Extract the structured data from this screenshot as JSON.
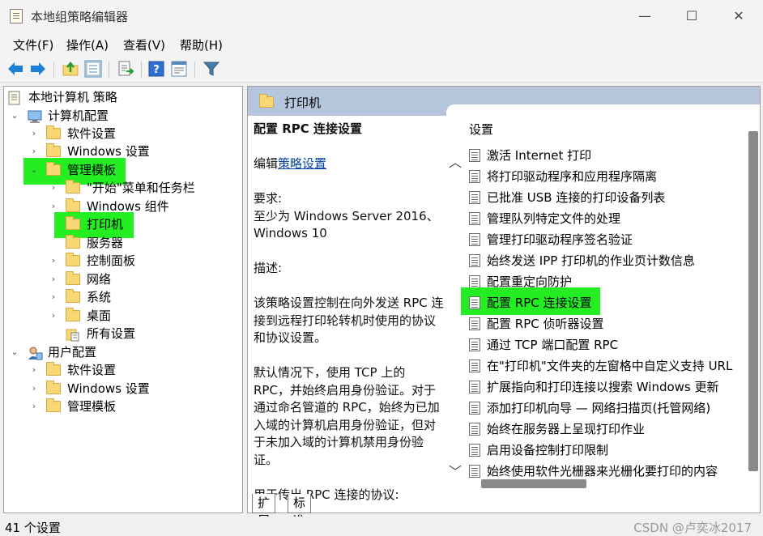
{
  "window": {
    "title": "本地组策略编辑器",
    "controls": {
      "minimize": "—",
      "maximize": "☐",
      "close": "✕"
    }
  },
  "menu": [
    {
      "label": "文件(F)"
    },
    {
      "label": "操作(A)"
    },
    {
      "label": "查看(V)"
    },
    {
      "label": "帮助(H)"
    }
  ],
  "toolbar": {
    "icons": [
      "back-arrow-icon",
      "forward-arrow-icon",
      "up-folder-icon",
      "show-hide-tree-icon",
      "export-list-icon",
      "help-icon",
      "properties-icon",
      "filter-icon"
    ],
    "colors": {
      "arrow": "#1e7fd6",
      "filter": "#4a7aa6"
    }
  },
  "tree": {
    "root": "本地计算机 策略",
    "items": [
      {
        "label": "计算机配置"
      },
      {
        "label": "软件设置"
      },
      {
        "label": "Windows 设置"
      },
      {
        "label": "管理模板"
      },
      {
        "label": "\"开始\"菜单和任务栏"
      },
      {
        "label": "Windows 组件"
      },
      {
        "label": "打印机"
      },
      {
        "label": "服务器"
      },
      {
        "label": "控制面板"
      },
      {
        "label": "网络"
      },
      {
        "label": "系统"
      },
      {
        "label": "桌面"
      },
      {
        "label": "所有设置"
      },
      {
        "label": "用户配置"
      },
      {
        "label": "软件设置"
      },
      {
        "label": "Windows 设置"
      },
      {
        "label": "管理模板"
      }
    ],
    "highlight_color": "#22ee22"
  },
  "right": {
    "header": "打印机",
    "header_color": "#b5c6dc",
    "description": {
      "title": "配置 RPC 连接设置",
      "edit_prefix": "编辑",
      "edit_link": "策略设置",
      "requirements_label": "要求:",
      "requirements_value": "至少为 Windows Server 2016、Windows 10",
      "desc_label": "描述:",
      "desc_p1": "该策略设置控制在向外发送 RPC 连接到远程打印轮转机时使用的协议和协议设置。",
      "desc_p2": "默认情况下，使用 TCP 上的 RPC，并始终启用身份验证。对于通过命名管道的 RPC，始终为已加入域的计算机启用身份验证，但对于未加入域的计算机禁用身份验证。",
      "desc_p3": "用于传出 RPC 连接的协议:"
    },
    "list": {
      "header": "设置",
      "rows": [
        {
          "label": "激活 Internet 打印"
        },
        {
          "label": "将打印驱动程序和应用程序隔离"
        },
        {
          "label": "已批准 USB 连接的打印设备列表"
        },
        {
          "label": "管理队列特定文件的处理"
        },
        {
          "label": "管理打印驱动程序签名验证"
        },
        {
          "label": "始终发送 IPP 打印机的作业页计数信息"
        },
        {
          "label": "配置重定向防护"
        },
        {
          "label": "配置 RPC 连接设置"
        },
        {
          "label": "配置 RPC 侦听器设置"
        },
        {
          "label": "通过 TCP 端口配置 RPC"
        },
        {
          "label": "在\"打印机\"文件夹的左窗格中自定义支持 URL"
        },
        {
          "label": "扩展指向和打印连接以搜索 Windows 更新"
        },
        {
          "label": "添加打印机向导 — 网络扫描页(托管网络)"
        },
        {
          "label": "始终在服务器上呈现打印作业"
        },
        {
          "label": "启用设备控制打印限制"
        },
        {
          "label": "始终使用软件光栅器来光栅化要打印的内容"
        }
      ]
    },
    "scroll": {
      "up": "︿",
      "down": "﹀"
    }
  },
  "tabs": [
    {
      "label": "扩展"
    },
    {
      "label": "标准"
    }
  ],
  "status": {
    "text": "41 个设置",
    "watermark": "CSDN @卢奕冰2017"
  }
}
